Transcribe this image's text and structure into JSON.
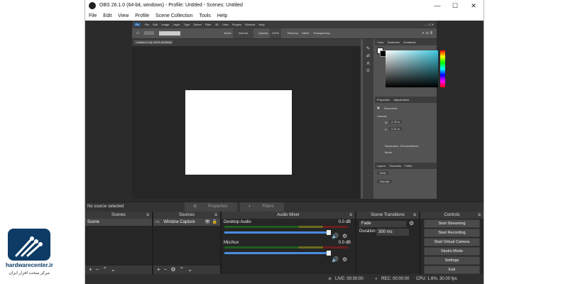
{
  "window": {
    "title": "OBS 26.1.0 (64-bit, windows) - Profile: Untitled - Scenes: Untitled"
  },
  "menu": [
    "File",
    "Edit",
    "View",
    "Profile",
    "Scene Collection",
    "Tools",
    "Help"
  ],
  "photoshop": {
    "menu": [
      "Ps",
      "File",
      "Edit",
      "Image",
      "Layer",
      "Type",
      "Select",
      "Filter",
      "3D",
      "View",
      "Plugins",
      "Window",
      "Help"
    ],
    "options": {
      "mode_label": "Mode:",
      "mode_value": "Normal",
      "opacity_label": "Opacity:",
      "opacity_value": "100%",
      "reverse": "Reverse",
      "dither": "Dither",
      "transparency": "Transparency"
    },
    "doc_tab": "Untitled-1 @ 100% (RGB/8)",
    "panel_tabs_top": [
      "Color",
      "Swatches",
      "Gradients"
    ],
    "panel_tabs_mid": [
      "Properties",
      "Adjustments"
    ],
    "document_label": "Document",
    "canvas_label": "Canvas",
    "w_label": "W",
    "w_value": "2.78 in",
    "h_label": "H",
    "h_value": "2.21 in",
    "resolution": "Resolution: 100 pixels/inch",
    "mode_label": "Mode",
    "panel_tabs_bottom": [
      "Layers",
      "Channels",
      "Paths"
    ],
    "layers_kind": "Kind",
    "layers_normal": "Normal"
  },
  "status_bar": {
    "no_source": "No source selected",
    "properties": "Properties",
    "filters": "Filters"
  },
  "docks": {
    "scenes": {
      "title": "Scenes",
      "items": [
        "Scene"
      ]
    },
    "sources": {
      "title": "Sources",
      "items": [
        "Window Capture"
      ]
    },
    "mixer": {
      "title": "Audio Mixer",
      "channels": [
        {
          "name": "Desktop Audio",
          "db": "0.0 dB"
        },
        {
          "name": "Mic/Aux",
          "db": "0.0 dB"
        }
      ]
    },
    "transitions": {
      "title": "Scene Transitions",
      "type": "Fade",
      "duration_label": "Duration",
      "duration_value": "300 ms"
    },
    "controls": {
      "title": "Controls",
      "buttons": [
        "Start Streaming",
        "Start Recording",
        "Start Virtual Camera",
        "Studio Mode",
        "Settings",
        "Exit"
      ]
    }
  },
  "bottom_status": {
    "live": "LIVE: 00:00:00",
    "rec": "REC: 00:00:00",
    "cpu": "CPU: 1.6%, 30.00 fps"
  },
  "watermark": {
    "brand": "hardwarecenter.ir",
    "subtitle": "مرکز سخت افزار ایران"
  }
}
